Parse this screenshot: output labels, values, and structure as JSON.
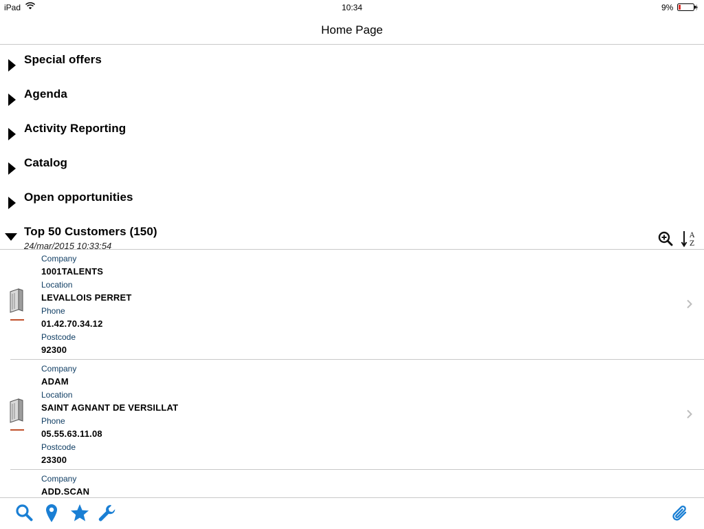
{
  "status_bar": {
    "device": "iPad",
    "time": "10:34",
    "battery": "9%"
  },
  "nav": {
    "title": "Home Page"
  },
  "sections": [
    {
      "label": "Special offers",
      "expanded": false
    },
    {
      "label": "Agenda",
      "expanded": false
    },
    {
      "label": "Activity Reporting",
      "expanded": false
    },
    {
      "label": "Catalog",
      "expanded": false
    },
    {
      "label": "Open opportunities",
      "expanded": false
    }
  ],
  "customers_section": {
    "label": "Top 50 Customers (150)",
    "timestamp": "24/mar/2015 10:33:54",
    "expanded": true
  },
  "field_labels": {
    "company": "Company",
    "location": "Location",
    "phone": "Phone",
    "postcode": "Postcode"
  },
  "customers": [
    {
      "company": "1001TALENTS",
      "location": "LEVALLOIS PERRET",
      "phone": "01.42.70.34.12",
      "postcode": "92300"
    },
    {
      "company": "ADAM",
      "location": "SAINT AGNANT DE VERSILLAT",
      "phone": "05.55.63.11.08",
      "postcode": "23300"
    },
    {
      "company": "ADD.SCAN"
    }
  ],
  "toolbar": {
    "icons": [
      "search-icon",
      "location-pin-icon",
      "star-icon",
      "wrench-icon",
      "paperclip-icon"
    ],
    "accent_color": "#1a7fd4"
  },
  "colors": {
    "field_label": "#0f3d63",
    "thumb_underline": "#c0502a",
    "accent": "#1a7fd4"
  }
}
